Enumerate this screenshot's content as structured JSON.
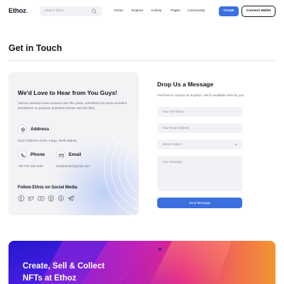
{
  "nav": {
    "logo_main": "Ethoz",
    "logo_dot": ".",
    "search_placeholder": "Search Ethoz",
    "menu": [
      "Home",
      "Explore",
      "Activity",
      "Pages",
      "Community"
    ],
    "create_label": "Create",
    "wallet_label": "Connect Wallet"
  },
  "page": {
    "title": "Get in Touch"
  },
  "contact_card": {
    "title": "We'd Love to Hear from You Guys!",
    "description": "Various versions have evolved over the years, sometimes by some accident sometimes on purpose (injected humour and the like).",
    "address_label": "Address",
    "address_value": "3102 Catherine Drive, Fargo, North Dakota",
    "phone_label": "Phone",
    "phone_value": "+59 701-332-1153",
    "email_label": "Email",
    "email_value": "vistothemes@gmail.com",
    "follow_label": "Follow Ethoz on Social Media",
    "social_icons": [
      "facebook-icon",
      "twitter-icon",
      "youtube-icon",
      "pinterest-icon",
      "skype-icon",
      "telegram-icon"
    ]
  },
  "form": {
    "title": "Drop Us a Message",
    "description": "Feel free to contact us anytime. We're available here for you.",
    "name_placeholder": "Your Full Name",
    "email_placeholder": "Your Email Address",
    "subject_placeholder": "Select Subject",
    "message_placeholder": "Your Message",
    "send_label": "Send Message"
  },
  "banner": {
    "line1": "Create, Sell & Collect",
    "line2": "NFTs at Ethoz"
  },
  "colors": {
    "accent": "#3b6fe0",
    "text": "#14141f",
    "muted": "#6d6e78"
  }
}
